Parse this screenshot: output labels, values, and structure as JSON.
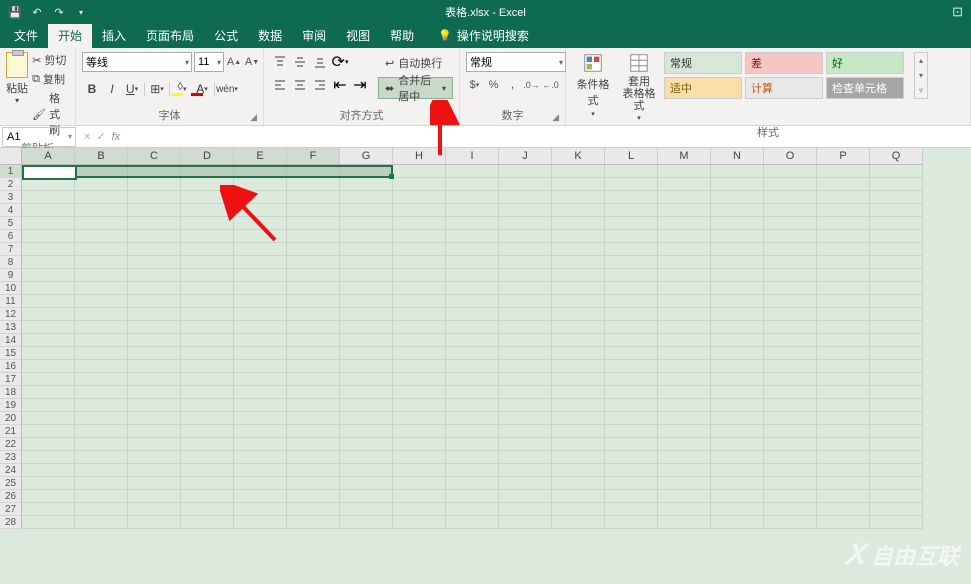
{
  "app": {
    "title": "表格.xlsx  -  Excel"
  },
  "tabs": {
    "file": "文件",
    "home": "开始",
    "insert": "插入",
    "layout": "页面布局",
    "formulas": "公式",
    "data": "数据",
    "review": "审阅",
    "view": "视图",
    "help": "帮助",
    "tellme": "操作说明搜索"
  },
  "clipboard": {
    "paste": "粘贴",
    "cut": "剪切",
    "copy": "复制",
    "painter": "格式刷",
    "label": "剪贴板"
  },
  "font": {
    "name": "等线",
    "size": "11",
    "label": "字体"
  },
  "align": {
    "wrap": "自动换行",
    "merge": "合并后居中",
    "label": "对齐方式"
  },
  "number": {
    "format": "常规",
    "label": "数字"
  },
  "styles": {
    "cond": "条件格式",
    "table": "套用\n表格格式",
    "normal": "常规",
    "bad": "差",
    "good": "好",
    "neutral": "适中",
    "calc": "计算",
    "check": "检查单元格",
    "label": "样式"
  },
  "namebox": "A1",
  "columns": [
    "A",
    "B",
    "C",
    "D",
    "E",
    "F",
    "G",
    "H",
    "I",
    "J",
    "K",
    "L",
    "M",
    "N",
    "O",
    "P",
    "Q"
  ],
  "rows_count": 28,
  "selected_cols": [
    "A",
    "B",
    "C",
    "D",
    "E",
    "F"
  ],
  "selected_row": 1,
  "watermark": "自由互联"
}
